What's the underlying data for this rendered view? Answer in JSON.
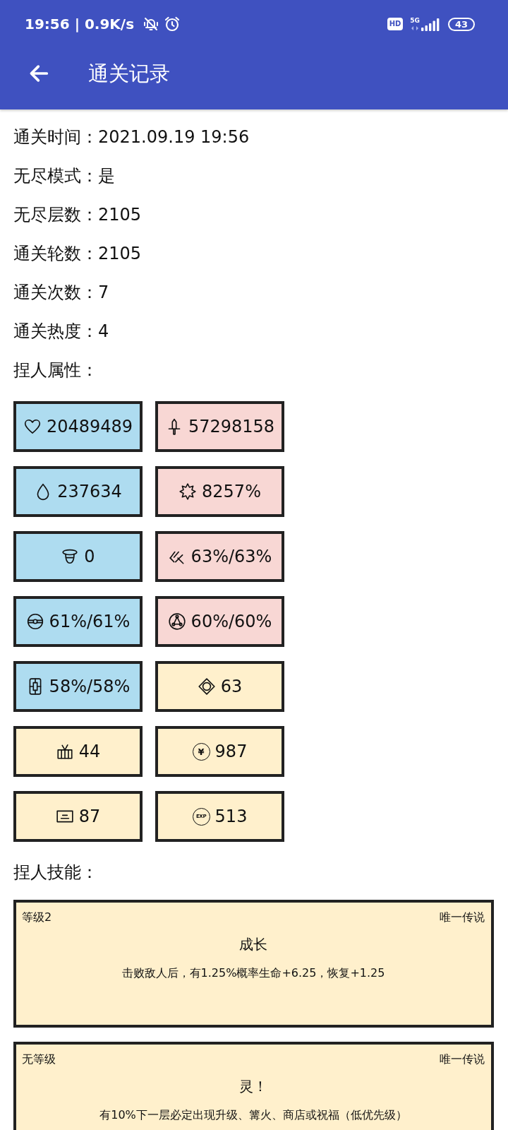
{
  "status_bar": {
    "time": "19:56 | 0.9K/s",
    "hd": "HD",
    "network": "5G",
    "battery": "43"
  },
  "toolbar": {
    "title": "通关记录"
  },
  "record": [
    "通关时间：2021.09.19 19:56",
    "无尽模式：是",
    "无尽层数：2105",
    "通关轮数：2105",
    "通关次数：7",
    "通关热度：4"
  ],
  "attributes_heading": "捏人属性：",
  "attributes": [
    {
      "value": "20489489",
      "color": "#aedcf0"
    },
    {
      "value": "57298158",
      "color": "#f8d7d4"
    },
    {
      "value": "237634",
      "color": "#aedcf0"
    },
    {
      "value": "8257%",
      "color": "#f8d7d4"
    },
    {
      "value": "0",
      "color": "#aedcf0"
    },
    {
      "value": "63%/63%",
      "color": "#f8d7d4"
    },
    {
      "value": "61%/61%",
      "color": "#aedcf0"
    },
    {
      "value": "60%/60%",
      "color": "#f8d7d4"
    },
    {
      "value": "58%/58%",
      "color": "#aedcf0"
    },
    {
      "value": "63",
      "color": "#fff0cc"
    },
    {
      "value": "44",
      "color": "#fff0cc"
    },
    {
      "value": "987",
      "color": "#fff0cc",
      "icon_text": "¥"
    },
    {
      "value": "87",
      "color": "#fff0cc"
    },
    {
      "value": "513",
      "color": "#fff0cc",
      "icon_text": "EXP"
    }
  ],
  "skills_heading": "捏人技能：",
  "skills": [
    {
      "level": "等级2",
      "rarity": "唯一传说",
      "name": "成长",
      "description": "击败敌人后，有1.25%概率生命+6.25，恢复+1.25"
    },
    {
      "level": "无等级",
      "rarity": "唯一传说",
      "name": "灵！",
      "description": "有10%下一层必定出现升级、篝火、商店或祝福（低优先级）"
    }
  ]
}
